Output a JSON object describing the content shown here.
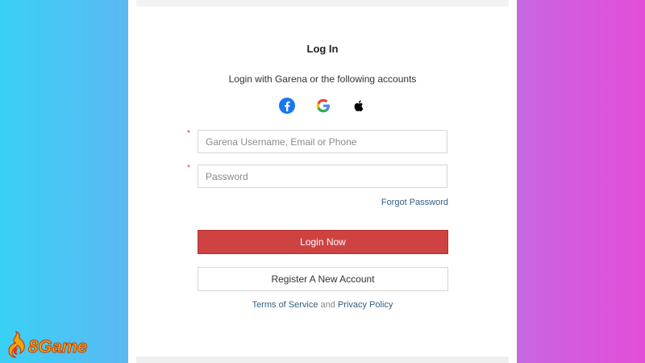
{
  "login": {
    "title": "Log In",
    "subtitle": "Login with Garena or the following accounts",
    "social": [
      {
        "name": "facebook",
        "icon": "facebook-icon",
        "color": "#1877f2"
      },
      {
        "name": "google",
        "icon": "google-icon",
        "color": "#4285f4"
      },
      {
        "name": "apple",
        "icon": "apple-icon",
        "color": "#000000"
      }
    ],
    "username_placeholder": "Garena Username, Email or Phone",
    "username_value": "",
    "password_placeholder": "Password",
    "password_value": "",
    "required_marker": "*",
    "forgot_password": "Forgot Password",
    "login_button": "Login Now",
    "register_button": "Register A New Account",
    "terms": "Terms of Service",
    "and": "and",
    "privacy": "Privacy Policy"
  },
  "brand": {
    "logo_text": "8Game",
    "color_primary": "#f4a10f",
    "color_outline": "#b8420a"
  },
  "colors": {
    "login_button": "#cf4242",
    "link": "#2f5f86",
    "required": "#dd3333",
    "bg_left": "#3ad0f6",
    "bg_right": "#e24ed8"
  }
}
